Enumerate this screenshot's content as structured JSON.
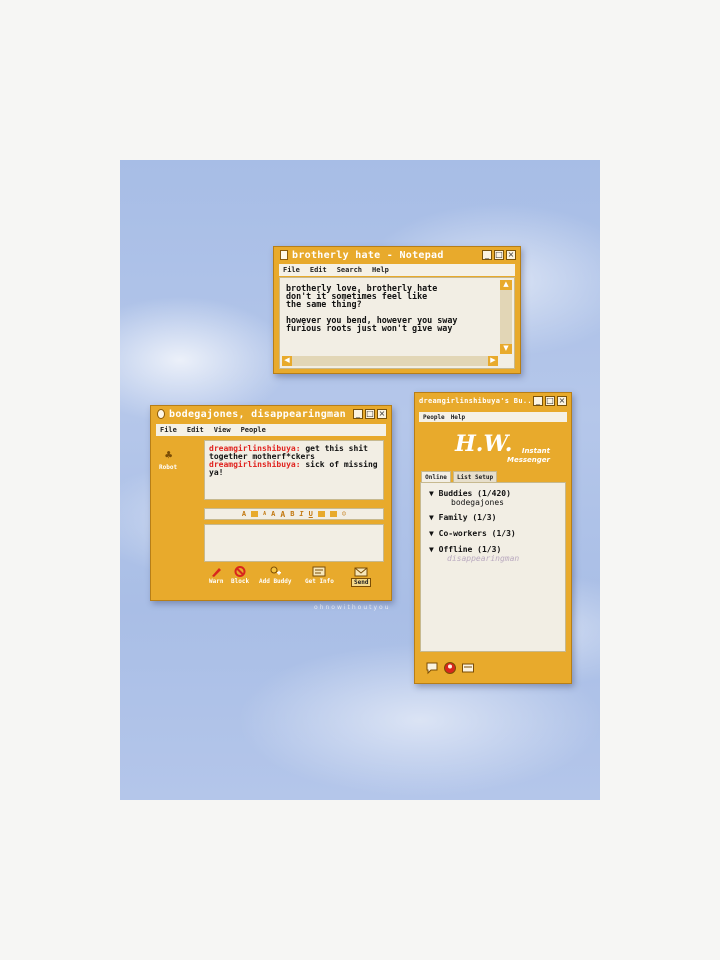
{
  "watermark": "ohnowithoutyou",
  "notepad": {
    "title": "brotherly hate - Notepad",
    "menu": [
      "File",
      "Edit",
      "Search",
      "Help"
    ],
    "text": "brotherly love, brotherly hate\ndon't it sometimes feel like\nthe same thing?\n\nhowever you bend, however you sway\nfurious roots just won't give way"
  },
  "chat": {
    "title": "bodegajones, disappearingman",
    "menu": [
      "File",
      "Edit",
      "View",
      "People"
    ],
    "robot_label": "Robot",
    "messages": [
      {
        "sender": "dreamgirlinshibuya:",
        "text": " get this shit together motherf*ckers"
      },
      {
        "sender": "dreamgirlinshibuya:",
        "text": " sick of missing ya!"
      }
    ],
    "format_glyphs": [
      "A",
      "A",
      "A",
      "A",
      "B",
      "I",
      "U"
    ],
    "actions": {
      "warn": "Warn",
      "block": "Block",
      "add_buddy": "Add Buddy",
      "get_info": "Get Info",
      "send": "Send"
    }
  },
  "buddylist": {
    "title": "dreamgirlinshibuya's Bu...",
    "menu": [
      "People",
      "Help"
    ],
    "logo": "H.W.",
    "logo_sub_1": "Instant",
    "logo_sub_2": "Messenger",
    "tabs": [
      "Online",
      "List Setup"
    ],
    "groups": [
      {
        "label": "Buddies (1/420)",
        "members": [
          "bodegajones"
        ]
      },
      {
        "label": "Family (1/3)",
        "members": []
      },
      {
        "label": "Co-workers (1/3)",
        "members": []
      },
      {
        "label": "Offline (1/3)",
        "members": [
          "disappearingman"
        ]
      }
    ]
  },
  "colors": {
    "window": "#e8aa2c",
    "panel": "#f2eee4",
    "screen_name": "#e0231f"
  }
}
